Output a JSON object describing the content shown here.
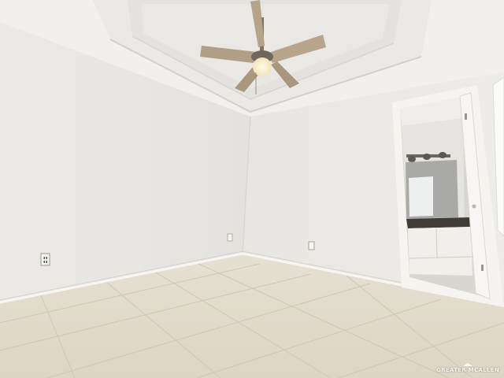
{
  "watermark": {
    "text": "GREATER MCALLEN"
  }
}
